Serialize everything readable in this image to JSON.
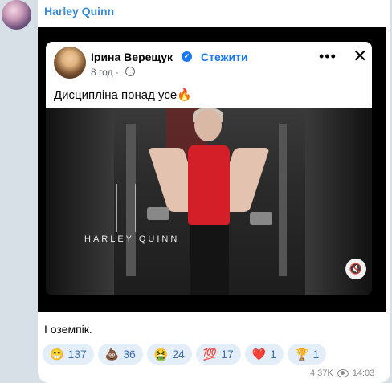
{
  "message": {
    "sender": "Harley Quinn",
    "text": "І оземпік.",
    "views": "4.37K",
    "time": "14:03"
  },
  "fb_post": {
    "author": "Ірина Верещук",
    "follow_label": "Стежити",
    "time": "8 год",
    "dot": "·",
    "more": "•••",
    "close": "✕",
    "text": "Дисципліна понад усе",
    "fire": "🔥",
    "watermark": "HARLEY QUINN",
    "mute_icon": "🔇"
  },
  "reactions": [
    {
      "emoji": "😁",
      "count": "137"
    },
    {
      "emoji": "💩",
      "count": "36"
    },
    {
      "emoji": "🤮",
      "count": "24"
    },
    {
      "emoji": "💯",
      "count": "17"
    },
    {
      "emoji": "❤️",
      "count": "1"
    },
    {
      "emoji": "🏆",
      "count": "1"
    }
  ],
  "colors": {
    "sender_name": "#3a8bd0",
    "reaction_bg": "#e4eef8",
    "fb_blue": "#1877f2"
  }
}
